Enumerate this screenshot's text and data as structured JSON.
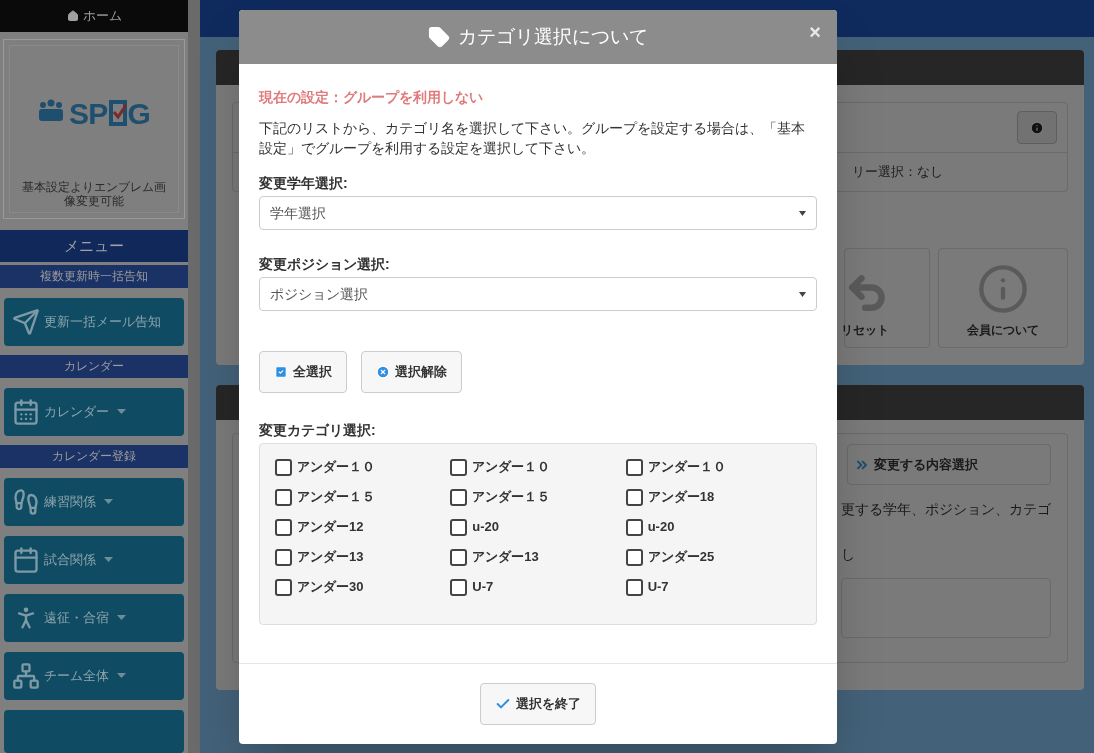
{
  "sidebar": {
    "home": "ホーム",
    "logo": {
      "left": "SP",
      "right": "G",
      "caption": "基本設定よりエンブレム画像変更可能"
    },
    "menu_title": "メニュー",
    "sections": [
      {
        "title": "複数更新時一括告知",
        "items": [
          {
            "label": "更新一括メール告知",
            "dropdown": false
          }
        ]
      },
      {
        "title": "カレンダー",
        "items": [
          {
            "label": "カレンダー",
            "dropdown": true
          }
        ]
      },
      {
        "title": "カレンダー登録",
        "items": [
          {
            "label": "練習関係",
            "dropdown": true
          },
          {
            "label": "試合関係",
            "dropdown": true
          },
          {
            "label": "遠征・合宿",
            "dropdown": true
          },
          {
            "label": "チーム全体",
            "dropdown": true
          }
        ]
      }
    ]
  },
  "main": {
    "status_text": "リー選択：なし",
    "tiles": [
      {
        "label": "リセット"
      },
      {
        "label": "会員について"
      }
    ],
    "change_button": "変更する内容選択",
    "change_text": "更する学年、ポジション、カテゴ",
    "change_text2": "し"
  },
  "modal": {
    "title": "カテゴリ選択について",
    "close": "×",
    "notice": "現在の設定：グループを利用しない",
    "description": "下記のリストから、カテゴリ名を選択して下さい。グループを設定する場合は、「基本設定」でグループを利用する設定を選択して下さい。",
    "fields": [
      {
        "label": "変更学年選択:",
        "value": "学年選択"
      },
      {
        "label": "変更ポジション選択:",
        "value": "ポジション選択"
      }
    ],
    "buttons": [
      {
        "label": "全選択"
      },
      {
        "label": "選択解除"
      }
    ],
    "category_label": "変更カテゴリ選択:",
    "categories": [
      {
        "label": "アンダー１０",
        "checked": false
      },
      {
        "label": "アンダー１０",
        "checked": false
      },
      {
        "label": "アンダー１０",
        "checked": false
      },
      {
        "label": "アンダー１５",
        "checked": false
      },
      {
        "label": "アンダー１５",
        "checked": false
      },
      {
        "label": "アンダー18",
        "checked": false
      },
      {
        "label": "アンダー12",
        "checked": false
      },
      {
        "label": "u-20",
        "checked": false
      },
      {
        "label": "u-20",
        "checked": false
      },
      {
        "label": "アンダー13",
        "checked": false
      },
      {
        "label": "アンダー13",
        "checked": false
      },
      {
        "label": "アンダー25",
        "checked": false
      },
      {
        "label": "アンダー30",
        "checked": false
      },
      {
        "label": "U-7",
        "checked": false
      },
      {
        "label": "U-7",
        "checked": false
      }
    ],
    "finish_button": "選択を終了"
  }
}
